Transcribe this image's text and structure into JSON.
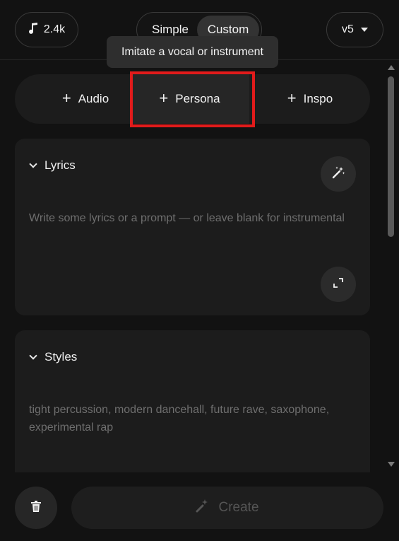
{
  "header": {
    "credits": "2.4k",
    "modes": [
      "Simple",
      "Custom"
    ],
    "active_mode": "Custom",
    "version": "v5"
  },
  "tooltip": "Imitate a vocal or instrument",
  "add_buttons": {
    "audio": "Audio",
    "persona": "Persona",
    "inspo": "Inspo",
    "plus_glyph": "+"
  },
  "lyrics": {
    "title": "Lyrics",
    "placeholder": "Write some lyrics or a prompt — or leave blank for instrumental"
  },
  "styles": {
    "title": "Styles",
    "placeholder": "tight percussion, modern dancehall, future rave, saxophone, experimental rap"
  },
  "footer": {
    "create_label": "Create"
  },
  "colors": {
    "highlight": "#e11b1b",
    "background": "#121212",
    "card": "#1c1c1c"
  },
  "icons": [
    "music-note-icon",
    "caret-down-icon",
    "chevron-down-icon",
    "magic-wand-icon",
    "expand-icon",
    "trash-icon",
    "create-sparkle-icon"
  ]
}
